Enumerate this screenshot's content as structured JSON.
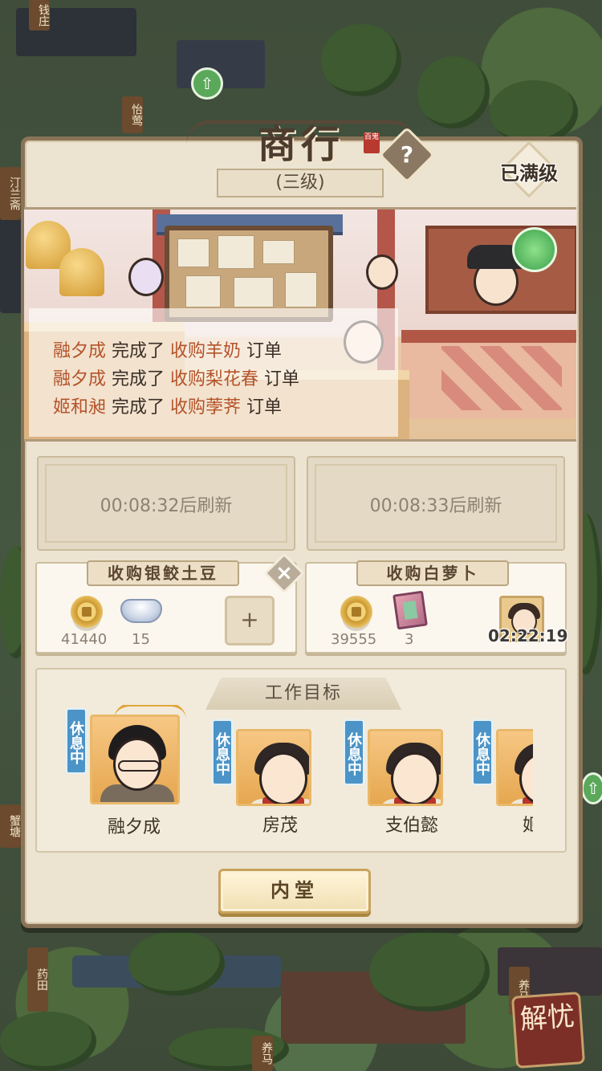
{
  "map_signs": [
    "钱庄",
    "怡莺",
    "汀兰斋",
    "蟹塘",
    "药田",
    "养马",
    "养马"
  ],
  "jieyou_label": "解忧",
  "shop": {
    "title": "商行",
    "seal_text": "百鬼",
    "level": "(三级)",
    "max_label": "已满级",
    "help_label": "?"
  },
  "order_feed": [
    {
      "who": "融夕成",
      "verb": "完成了",
      "item": "收购羊奶",
      "suffix": "订单"
    },
    {
      "who": "融夕成",
      "verb": "完成了",
      "item": "收购梨花春",
      "suffix": "订单"
    },
    {
      "who": "姬和昶",
      "verb": "完成了",
      "item": "收购荸荠",
      "suffix": "订单"
    }
  ],
  "refresh_slots": [
    {
      "text": "00:08:32后刷新"
    },
    {
      "text": "00:08:33后刷新"
    }
  ],
  "orders": [
    {
      "name": "收购银鲛土豆",
      "coin_qty": "41440",
      "item_qty": "15",
      "item_icon": "silver-ingot-icon",
      "action": "+"
    },
    {
      "name": "收购白萝卜",
      "coin_qty": "39555",
      "item_qty": "3",
      "item_icon": "book-icon",
      "timer": "02:22:19"
    }
  ],
  "close_label": "×",
  "work_target": {
    "title": "工作目标",
    "rest_label": "休息中",
    "workers": [
      {
        "name": "融夕成"
      },
      {
        "name": "房茂"
      },
      {
        "name": "支伯懿"
      },
      {
        "name": "姬和"
      }
    ]
  },
  "inner_hall_label": "内堂",
  "colors": {
    "accent_text": "#b4532a",
    "rest_badge": "#4c94c7",
    "panel_bg": "#ece3d1"
  }
}
